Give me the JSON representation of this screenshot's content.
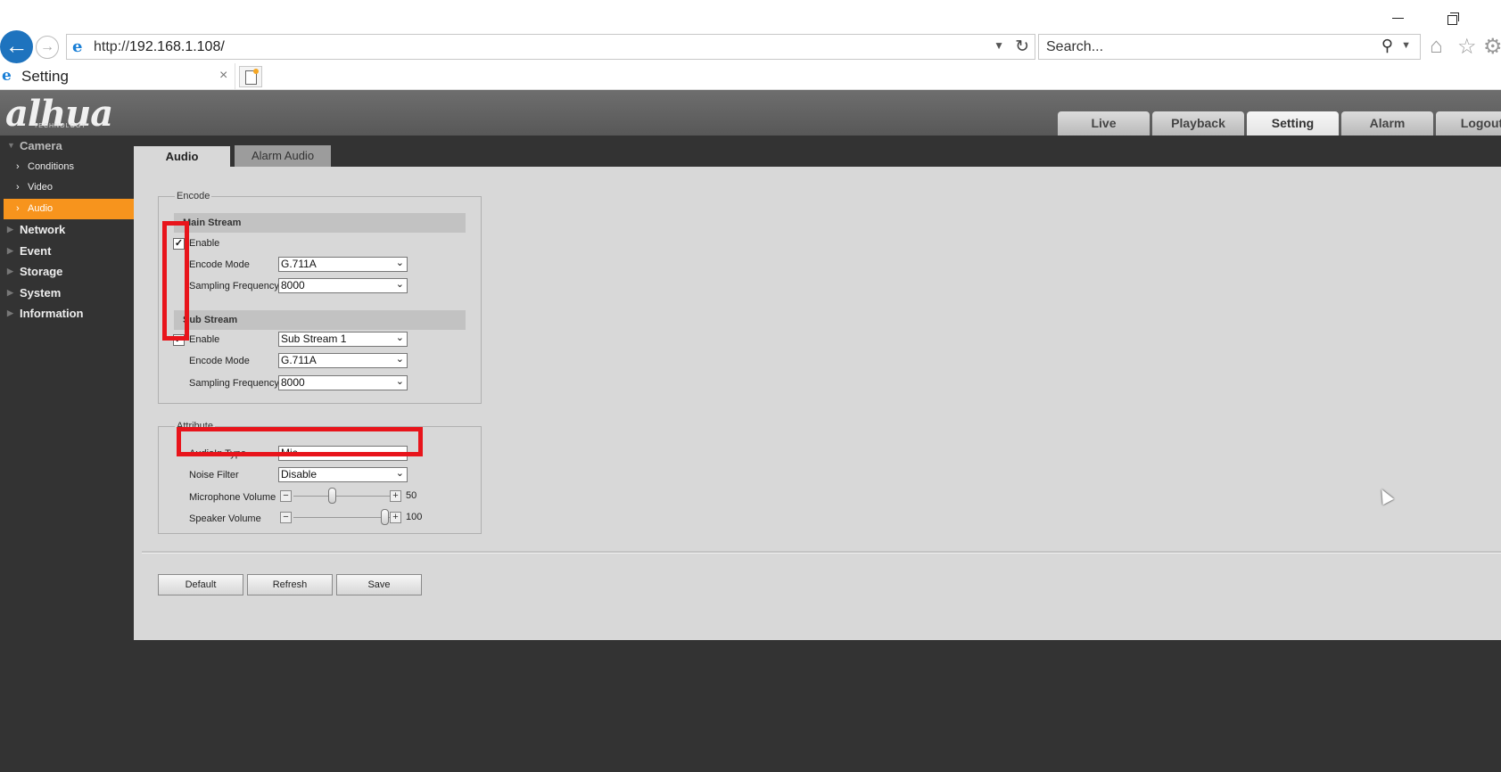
{
  "browser": {
    "address": "http://192.168.1.108/",
    "address_prefix": "http://",
    "address_host": "192.168.1.108/",
    "search_placeholder": "Search...",
    "tab_title": "Setting",
    "tab_close": "×"
  },
  "header": {
    "logo": "alhua",
    "logo_sub": "TECHNOLOGY",
    "nav": [
      "Live",
      "Playback",
      "Setting",
      "Alarm",
      "Logout"
    ],
    "nav_active": "Setting"
  },
  "sidebar": {
    "groups": [
      {
        "label": "Camera",
        "open": true,
        "items": [
          "Conditions",
          "Video",
          "Audio"
        ],
        "active_item": "Audio"
      },
      {
        "label": "Network"
      },
      {
        "label": "Event"
      },
      {
        "label": "Storage"
      },
      {
        "label": "System"
      },
      {
        "label": "Information"
      }
    ]
  },
  "tabs": [
    "Audio",
    "Alarm Audio"
  ],
  "encode": {
    "legend": "Encode",
    "main_stream": {
      "heading": "Main Stream",
      "enable_label": "Enable",
      "enabled": true,
      "encode_mode_label": "Encode Mode",
      "encode_mode": "G.711A",
      "sampling_label": "Sampling Frequency",
      "sampling": "8000"
    },
    "sub_stream": {
      "heading": "Sub Stream",
      "enable_label": "Enable",
      "enabled": true,
      "stream_select": "Sub Stream 1",
      "encode_mode_label": "Encode Mode",
      "encode_mode": "G.711A",
      "sampling_label": "Sampling Frequency",
      "sampling": "8000"
    }
  },
  "attribute": {
    "legend": "Attribute",
    "audioin_label": "AudioIn Type",
    "audioin": "Mic",
    "noise_label": "Noise Filter",
    "noise": "Disable",
    "mic_label": "Microphone Volume",
    "mic_value": "50",
    "speaker_label": "Speaker Volume",
    "speaker_value": "100"
  },
  "buttons": {
    "default": "Default",
    "refresh": "Refresh",
    "save": "Save"
  },
  "colors": {
    "accent": "#f7941d",
    "highlight": "#e8141b",
    "header": "#5e5e5e"
  },
  "icons": {
    "check": "✓",
    "arrow": "⌄",
    "minus": "−",
    "plus": "+"
  }
}
